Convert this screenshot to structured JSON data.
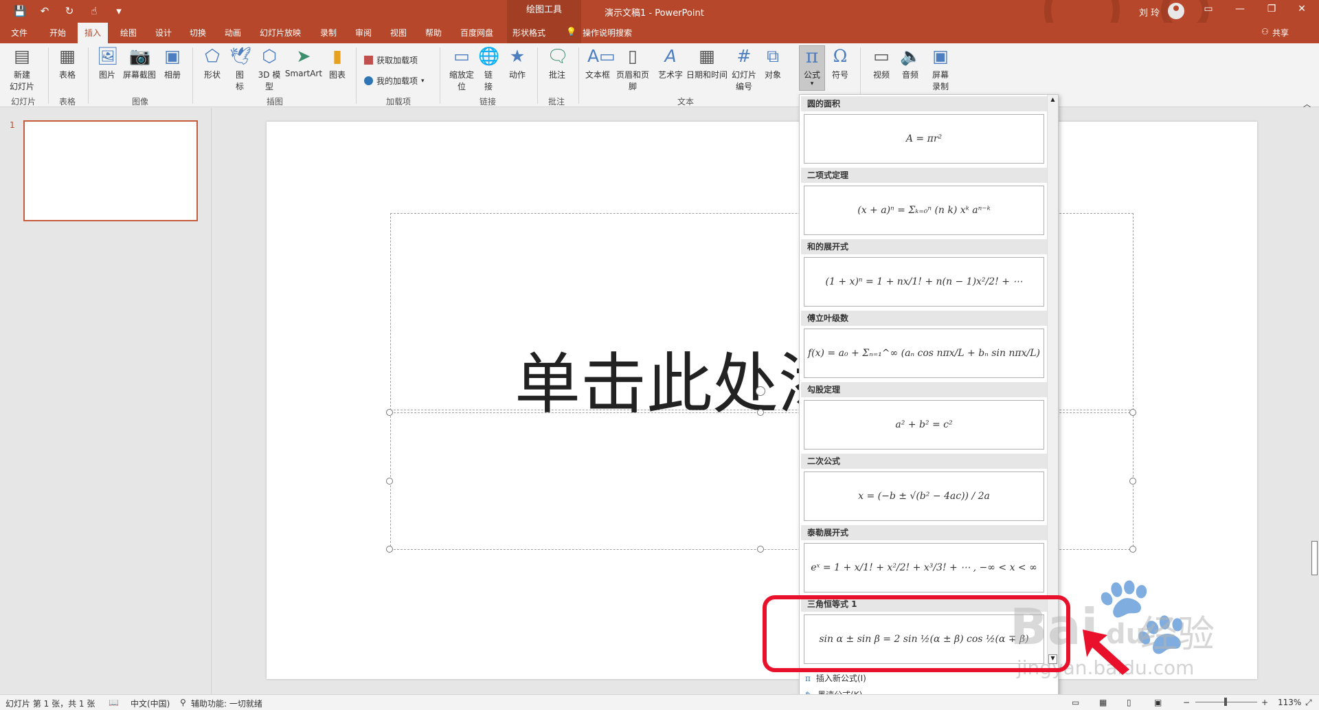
{
  "title_bar": {
    "contextual_tab_group": "绘图工具",
    "document_title": "演示文稿1  -  PowerPoint",
    "user": "刘 玲"
  },
  "tabs": [
    "文件",
    "开始",
    "插入",
    "绘图",
    "设计",
    "切换",
    "动画",
    "幻灯片放映",
    "录制",
    "审阅",
    "视图",
    "帮助",
    "百度网盘",
    "形状格式"
  ],
  "active_tab": "插入",
  "tell_me": "操作说明搜索",
  "share": "共享",
  "ribbon": {
    "new_slide": "新建\n幻灯片",
    "table": "表格",
    "picture": "图片",
    "screenshot": "屏幕截图",
    "album": "相册",
    "shapes": "形状",
    "icons": "图\n标",
    "model3d": "3D 模\n型",
    "smartart": "SmartArt",
    "chart": "图表",
    "get_addins": "获取加载项",
    "my_addins": "我的加载项",
    "zoom": "缩放定\n位",
    "link": "链\n接",
    "action": "动作",
    "comment": "批注",
    "textbox": "文本框",
    "header_footer": "页眉和页脚",
    "wordart": "艺术字",
    "datetime": "日期和时间",
    "slide_number": "幻灯片\n编号",
    "object": "对象",
    "equation": "公式",
    "symbol": "符号",
    "video": "视频",
    "audio": "音频",
    "screen_record": "屏幕\n录制",
    "groups": [
      "幻灯片",
      "表格",
      "图像",
      "插图",
      "加载项",
      "链接",
      "批注",
      "文本"
    ]
  },
  "thumbnail": {
    "number": "1"
  },
  "slide": {
    "title_placeholder": "单击此处添"
  },
  "gallery": {
    "sections": [
      {
        "title": "圆的面积",
        "formula": "A = πr²"
      },
      {
        "title": "二项式定理",
        "formula": "(x + a)ⁿ = Σₖ₌₀ⁿ (n k) xᵏ aⁿ⁻ᵏ"
      },
      {
        "title": "和的展开式",
        "formula": "(1 + x)ⁿ = 1 + nx/1! + n(n − 1)x²/2! + ⋯"
      },
      {
        "title": "傅立叶级数",
        "formula": "f(x) = a₀ + Σₙ₌₁^∞ (aₙ cos nπx/L + bₙ sin nπx/L)"
      },
      {
        "title": "勾股定理",
        "formula": "a² + b² = c²"
      },
      {
        "title": "二次公式",
        "formula": "x = (−b ± √(b² − 4ac)) / 2a"
      },
      {
        "title": "泰勒展开式",
        "formula": "eˣ = 1 + x/1! + x²/2! + x³/3! + ⋯ ,     −∞ < x < ∞"
      },
      {
        "title": "三角恒等式 1",
        "formula": "sin α ± sin β = 2 sin ½(α ± β) cos ½(α ∓ β)"
      }
    ],
    "insert_new": "插入新公式(I)",
    "ink_equation": "墨迹公式(K)"
  },
  "watermark": {
    "brand": "Bai",
    "brand2": "du",
    "site": "经验",
    "url": "jingyan.baidu.com"
  },
  "statusbar": {
    "slide_info": "幻灯片 第 1 张，共 1 张",
    "language": "中文(中国)",
    "accessibility": "辅助功能: 一切就绪",
    "zoom": "113%"
  },
  "colors": {
    "accent": "#b7472a",
    "highlight": "#e8102a"
  }
}
